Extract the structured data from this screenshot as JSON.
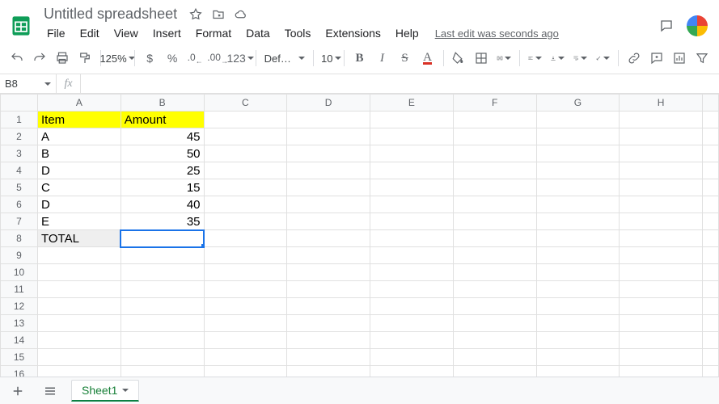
{
  "doc": {
    "title": "Untitled spreadsheet"
  },
  "menus": [
    "File",
    "Edit",
    "View",
    "Insert",
    "Format",
    "Data",
    "Tools",
    "Extensions",
    "Help"
  ],
  "last_edit": "Last edit was seconds ago",
  "toolbar": {
    "zoom": "125%",
    "currency": "$",
    "percent": "%",
    "dec_dec": ".0",
    "inc_dec": ".00",
    "num_format": "123",
    "font": "Default (Ari...",
    "font_size": "10",
    "bold": "B",
    "italic": "I",
    "text_color": "A"
  },
  "name_box": "B8",
  "fx_label": "fx",
  "formula": "",
  "columns": [
    "A",
    "B",
    "C",
    "D",
    "E",
    "F",
    "G",
    "H"
  ],
  "row_count_visible": 16,
  "chart_data": {
    "type": "table",
    "headers": [
      "Item",
      "Amount"
    ],
    "rows": [
      {
        "item": "A",
        "amount": 45
      },
      {
        "item": "B",
        "amount": 50
      },
      {
        "item": "D",
        "amount": 25
      },
      {
        "item": "C",
        "amount": 15
      },
      {
        "item": "D",
        "amount": 40
      },
      {
        "item": "E",
        "amount": 35
      }
    ],
    "total_label": "TOTAL"
  },
  "active_cell": {
    "row": 8,
    "col": "B"
  },
  "sheets": {
    "active": "Sheet1"
  }
}
